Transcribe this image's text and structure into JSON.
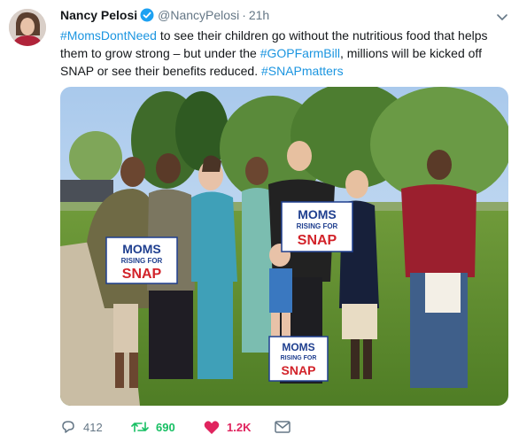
{
  "author": {
    "name": "Nancy Pelosi",
    "handle": "@NancyPelosi",
    "separator": "·",
    "time": "21h"
  },
  "tweet": {
    "segments": [
      {
        "text": "#MomsDontNeed",
        "hashtag": true
      },
      {
        "text": " to see their children go without the nutritious food that helps them to grow strong – but under the ",
        "hashtag": false
      },
      {
        "text": "#GOPFarmBill",
        "hashtag": true
      },
      {
        "text": ", millions will be kicked off SNAP or see their benefits reduced. ",
        "hashtag": false
      },
      {
        "text": "#SNAPmatters",
        "hashtag": true
      }
    ]
  },
  "photo": {
    "signs": [
      {
        "line1": "MOMS",
        "line2": "RISING FOR",
        "line3": "SNAP"
      },
      {
        "line1": "MOMS",
        "line2": "RISING FOR",
        "line3": "SNAP"
      },
      {
        "line1": "MOMS",
        "line2": "RISING FOR",
        "line3": "SNAP"
      }
    ]
  },
  "actions": {
    "replies": "412",
    "retweets": "690",
    "likes": "1.2K"
  },
  "colors": {
    "link": "#1b95e0",
    "muted": "#657786",
    "retweet": "#17bf63",
    "like": "#e0245e",
    "sign_blue": "#1f3f8f",
    "sign_red": "#d2232a"
  },
  "icons": [
    "verified-badge-icon",
    "caret-down-icon",
    "reply-icon",
    "retweet-icon",
    "heart-icon",
    "direct-message-icon"
  ]
}
